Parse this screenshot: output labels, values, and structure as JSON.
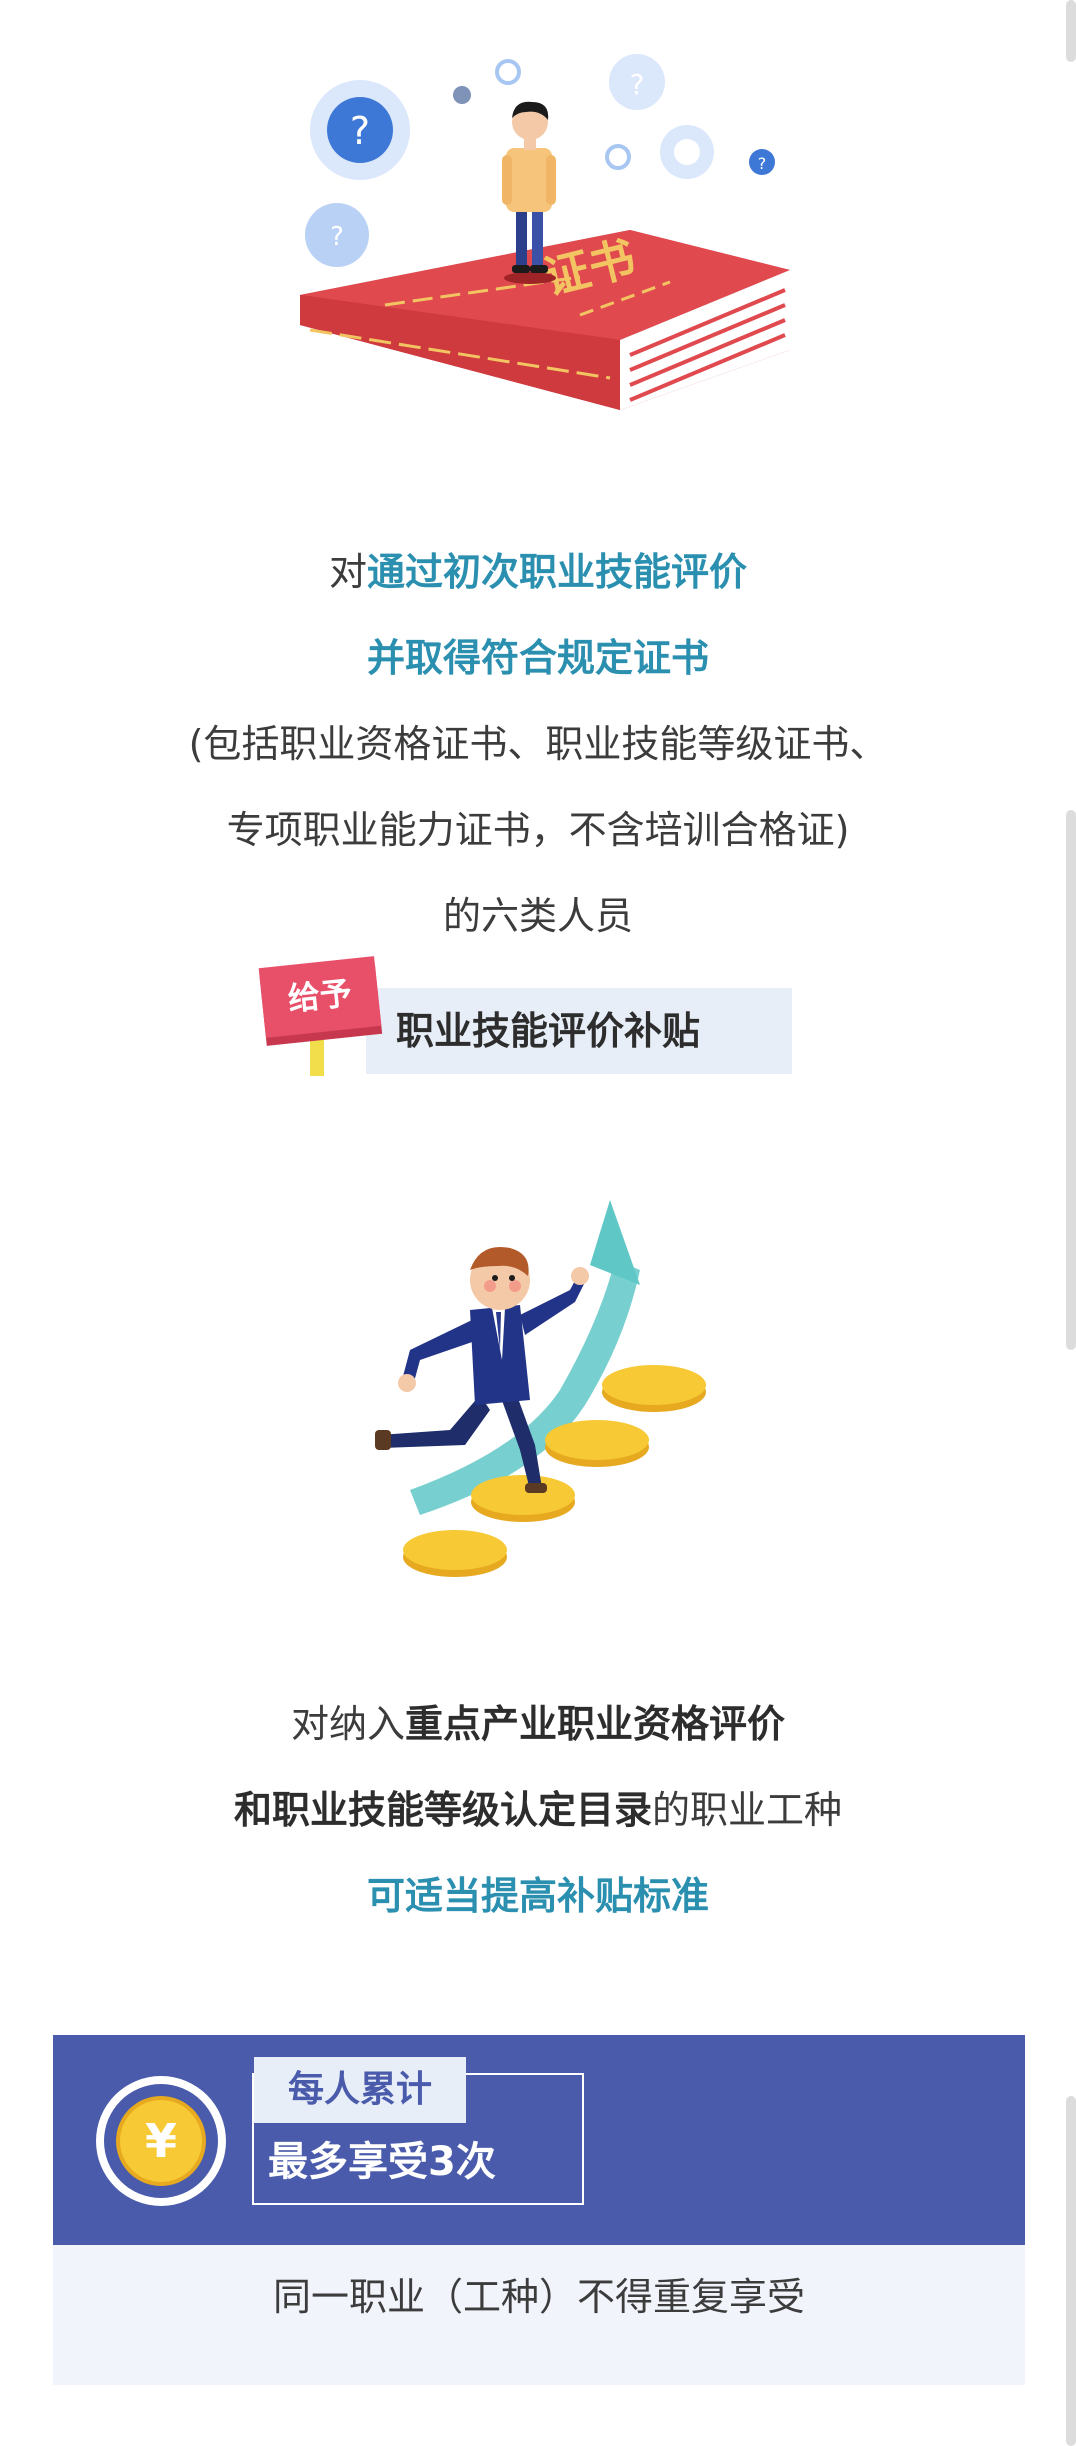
{
  "section1": {
    "illustration_book_text": "证书",
    "line1": {
      "plain": "对",
      "highlight": "通过初次职业技能评价"
    },
    "line2": "并取得符合规定证书",
    "line3": "(包括职业资格证书、职业技能等级证书、",
    "line4": "专项职业能力证书，不含培训合格证)",
    "line5": "的六类人员",
    "sign_label": "给予",
    "banner_text": "职业技能评价补贴"
  },
  "section2": {
    "line1": {
      "plain": "对纳入",
      "bold": "重点产业职业资格评价"
    },
    "line2": {
      "bold": "和职业技能等级认定目录",
      "plain": "的职业工种"
    },
    "line3": "可适当提高补贴标准"
  },
  "section3": {
    "coin_symbol": "¥",
    "tag_label": "每人累计",
    "main_text": "最多享受3次",
    "note": "同一职业（工种）不得重复享受"
  },
  "colors": {
    "accent_blue": "#2b8fb0",
    "panel_blue": "#4a5bab",
    "book_red": "#d93b3f",
    "sign_pink": "#e8506a",
    "coin_gold": "#f2c12e"
  }
}
